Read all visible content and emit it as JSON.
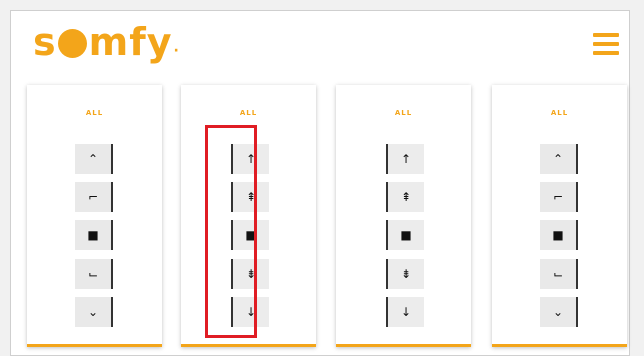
{
  "header": {
    "logo_prefix": "s",
    "logo_suffix": "mfy",
    "logo_mark": "·",
    "menu_icon": "hamburger-menu-icon"
  },
  "colors": {
    "brand": "#f3a51a",
    "highlight": "#e01d24",
    "button_bg": "#e9e9e9"
  },
  "panels": [
    {
      "label": "ALL",
      "buttons": [
        {
          "glyph": "⌃",
          "icon": "chevron-up-icon"
        },
        {
          "glyph": "⌐",
          "icon": "my-position-icon"
        },
        {
          "glyph": "■",
          "icon": "stop-icon"
        },
        {
          "glyph": "⌙",
          "icon": "my-position-down-icon"
        },
        {
          "glyph": "⌄",
          "icon": "chevron-down-icon"
        }
      ]
    },
    {
      "label": "ALL",
      "buttons": [
        {
          "glyph": "↑",
          "icon": "arrow-up-icon"
        },
        {
          "glyph": "⇞",
          "icon": "arrow-up-limit-icon"
        },
        {
          "glyph": "■",
          "icon": "stop-icon"
        },
        {
          "glyph": "⇟",
          "icon": "arrow-down-limit-icon"
        },
        {
          "glyph": "↓",
          "icon": "arrow-down-icon"
        }
      ]
    },
    {
      "label": "ALL",
      "buttons": [
        {
          "glyph": "↑",
          "icon": "arrow-up-icon"
        },
        {
          "glyph": "⇞",
          "icon": "arrow-up-limit-icon"
        },
        {
          "glyph": "■",
          "icon": "stop-icon"
        },
        {
          "glyph": "⇟",
          "icon": "arrow-down-limit-icon"
        },
        {
          "glyph": "↓",
          "icon": "arrow-down-icon"
        }
      ]
    },
    {
      "label": "ALL",
      "buttons": [
        {
          "glyph": "⌃",
          "icon": "chevron-up-icon"
        },
        {
          "glyph": "⌐",
          "icon": "my-position-icon"
        },
        {
          "glyph": "■",
          "icon": "stop-icon"
        },
        {
          "glyph": "⌙",
          "icon": "my-position-down-icon"
        },
        {
          "glyph": "⌄",
          "icon": "chevron-down-icon"
        }
      ]
    }
  ]
}
